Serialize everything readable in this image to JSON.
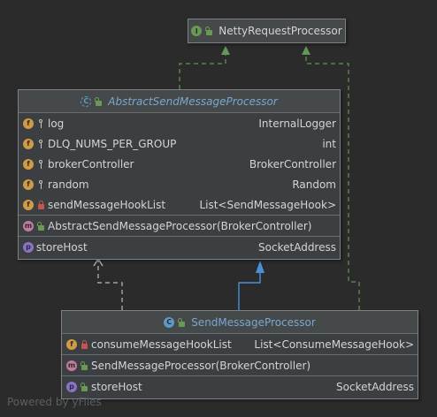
{
  "interface_node": {
    "badge": "I",
    "title": "NettyRequestProcessor"
  },
  "abstract_node": {
    "badge": "C",
    "title": "AbstractSendMessageProcessor",
    "fields": [
      {
        "badge": "f",
        "name": "log",
        "type": "InternalLogger",
        "visibility": "static-final"
      },
      {
        "badge": "f",
        "name": "DLQ_NUMS_PER_GROUP",
        "type": "int",
        "visibility": "static-final"
      },
      {
        "badge": "f",
        "name": "brokerController",
        "type": "BrokerController",
        "visibility": "static-final"
      },
      {
        "badge": "f",
        "name": "random",
        "type": "Random",
        "visibility": "static-final"
      },
      {
        "badge": "f",
        "name": "sendMessageHookList",
        "type": "List<SendMessageHook>",
        "visibility": "private"
      }
    ],
    "methods": [
      {
        "badge": "m",
        "name": "AbstractSendMessageProcessor(BrokerController)",
        "visibility": "public"
      }
    ],
    "properties": [
      {
        "badge": "p",
        "name": "storeHost",
        "type": "SocketAddress",
        "visibility": "public"
      }
    ]
  },
  "class_node": {
    "badge": "C",
    "title": "SendMessageProcessor",
    "fields": [
      {
        "badge": "f",
        "name": "consumeMessageHookList",
        "type": "List<ConsumeMessageHook>",
        "visibility": "private"
      }
    ],
    "methods": [
      {
        "badge": "m",
        "name": "SendMessageProcessor(BrokerController)",
        "visibility": "public"
      }
    ],
    "properties": [
      {
        "badge": "p",
        "name": "storeHost",
        "type": "SocketAddress",
        "visibility": "public"
      }
    ]
  },
  "edges": {
    "realization_color": "#629755",
    "inheritance_color": "#4a90d9",
    "dependency_color": "#bbbbbb"
  },
  "watermark": "Powered by yFiles"
}
